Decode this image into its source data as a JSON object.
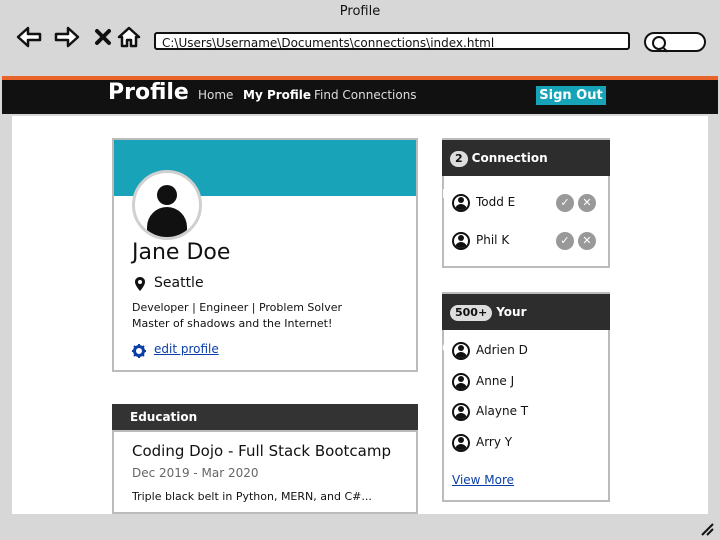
{
  "window": {
    "title": "Profile"
  },
  "browser": {
    "url": "C:\\Users\\Username\\Documents\\connections\\index.html",
    "icons": [
      "back-arrow-icon",
      "forward-arrow-icon",
      "close-x-icon",
      "home-icon",
      "search-icon"
    ]
  },
  "navbar": {
    "brand": "Profile",
    "links": [
      {
        "label": "Home",
        "active": false
      },
      {
        "label": "My Profile",
        "active": true
      },
      {
        "label": "Find Connections",
        "active": false
      }
    ],
    "signout": "Sign Out"
  },
  "profile": {
    "name": "Jane Doe",
    "location": "Seattle",
    "bio_line1": "Developer | Engineer | Problem Solver",
    "bio_line2": "Master of shadows and the Internet!",
    "edit_label": "edit profile"
  },
  "education": {
    "header": "Education",
    "title": "Coding Dojo - Full Stack Bootcamp",
    "dates": "Dec 2019 - Mar 2020",
    "description": "Triple black belt in Python, MERN, and C#..."
  },
  "requests": {
    "count": "2",
    "title": "Connection Requests",
    "people": [
      "Todd E",
      "Phil K"
    ]
  },
  "connections": {
    "count": "500+",
    "title": "Your Connections",
    "people": [
      "Adrien D",
      "Anne J",
      "Alayne T",
      "Arry Y"
    ],
    "view_more": "View More"
  },
  "colors": {
    "accent": "#18a3b8",
    "navbar": "#111111",
    "header_dark": "#2d2d2d",
    "link": "#0a3ea8"
  }
}
